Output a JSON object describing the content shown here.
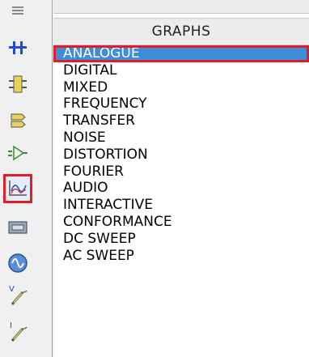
{
  "panel": {
    "header": "GRAPHS",
    "items": [
      {
        "label": "ANALOGUE",
        "selected": true
      },
      {
        "label": "DIGITAL"
      },
      {
        "label": "MIXED"
      },
      {
        "label": "FREQUENCY"
      },
      {
        "label": "TRANSFER"
      },
      {
        "label": "NOISE"
      },
      {
        "label": "DISTORTION"
      },
      {
        "label": "FOURIER"
      },
      {
        "label": "AUDIO"
      },
      {
        "label": "INTERACTIVE"
      },
      {
        "label": "CONFORMANCE"
      },
      {
        "label": "DC SWEEP"
      },
      {
        "label": "AC SWEEP"
      }
    ]
  },
  "toolbar": {
    "tools": [
      {
        "icon": "text-lines-icon"
      },
      {
        "icon": "bus-icon"
      },
      {
        "icon": "subcircuit-icon"
      },
      {
        "icon": "terminal-icon"
      },
      {
        "icon": "device-pin-icon"
      },
      {
        "icon": "graph-icon",
        "selected": true
      },
      {
        "icon": "tape-recorder-icon"
      },
      {
        "icon": "generator-icon"
      },
      {
        "icon": "voltage-probe-icon",
        "letter": "V"
      },
      {
        "icon": "current-probe-icon",
        "letter": "I"
      }
    ]
  },
  "colors": {
    "selection": "#3d8ddb",
    "highlight": "#e11d2a",
    "toolbar": "#f0f0f0"
  }
}
